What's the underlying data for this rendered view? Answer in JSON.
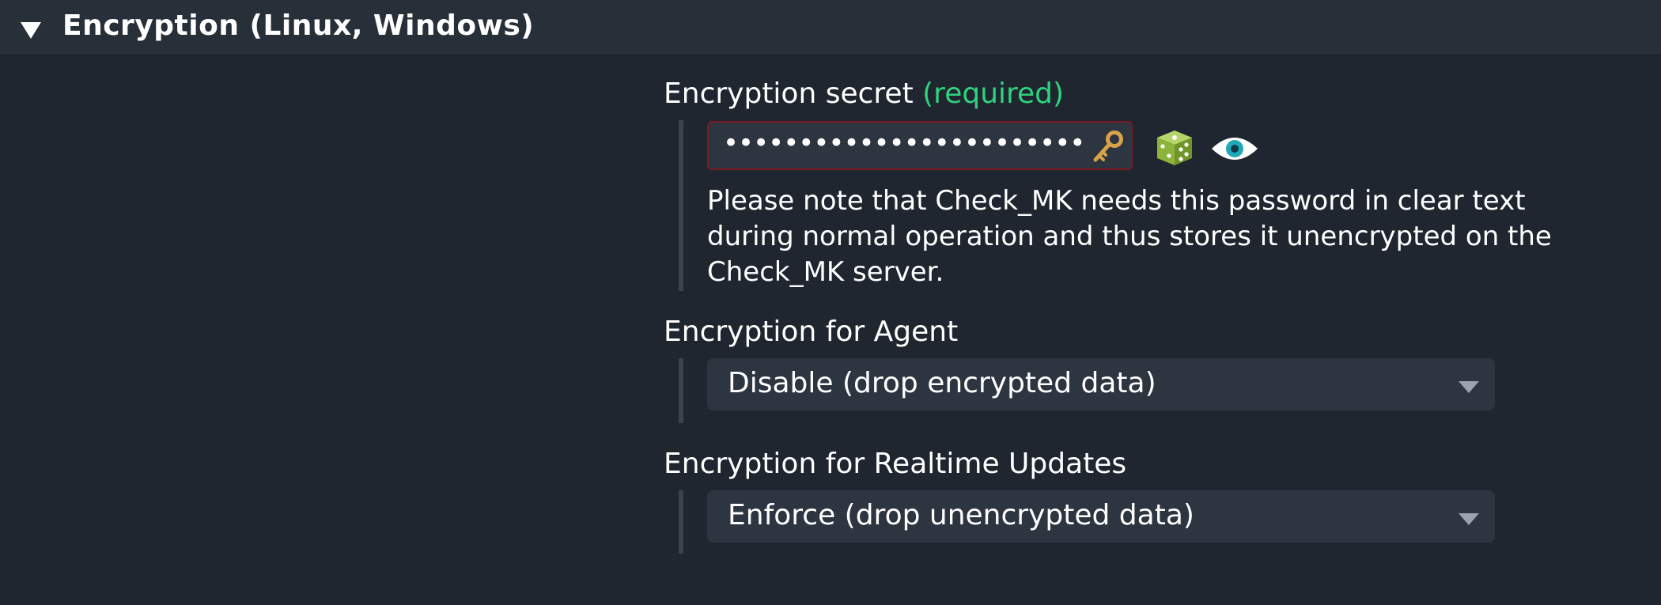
{
  "section": {
    "title": "Encryption (Linux, Windows)",
    "expanded_icon": "triangle-down-icon"
  },
  "secret": {
    "label": "Encryption secret",
    "required_label": "(required)",
    "masked_value": "••••••••••••••••••••••••",
    "key_icon": "key-icon",
    "dice_icon": "dice-icon",
    "eye_icon": "eye-icon",
    "help": "Please note that Check_MK needs this password in clear text during normal operation and thus stores it unencrypted on the Check_MK server."
  },
  "agent": {
    "label": "Encryption for Agent",
    "selected": "Disable (drop encrypted data)"
  },
  "realtime": {
    "label": "Encryption for Realtime Updates",
    "selected": "Enforce (drop unencrypted data)"
  },
  "colors": {
    "background": "#1f262f",
    "header_background": "#272f39",
    "input_background": "#2d3541",
    "required_green": "#2fd37d",
    "error_border": "#7a1a24"
  }
}
